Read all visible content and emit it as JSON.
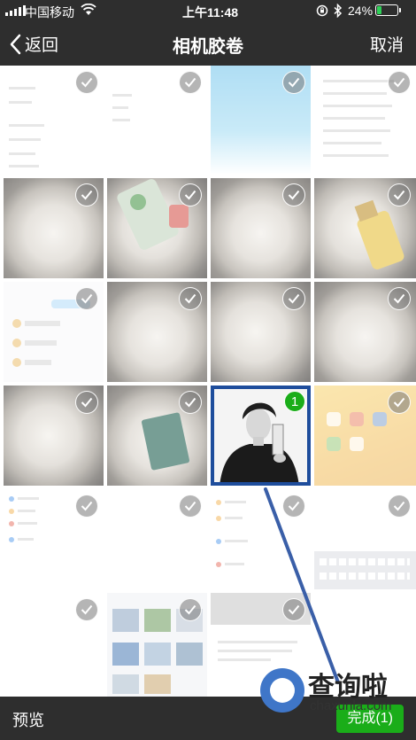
{
  "status_bar": {
    "carrier": "中国移动",
    "time": "上午11:48",
    "battery_percent": "24%",
    "battery_level": 0.24
  },
  "nav": {
    "back_label": "返回",
    "title": "相机胶卷",
    "cancel_label": "取消"
  },
  "grid": {
    "selected_count": "1"
  },
  "bottom": {
    "preview_label": "预览",
    "done_label": "完成(1)"
  },
  "watermark": {
    "name": "查询啦",
    "domain": "chaxunla.com"
  },
  "colors": {
    "bar_bg": "#2e2e2e",
    "accent_green": "#1aad19",
    "selected_border": "#1e4d9c"
  }
}
